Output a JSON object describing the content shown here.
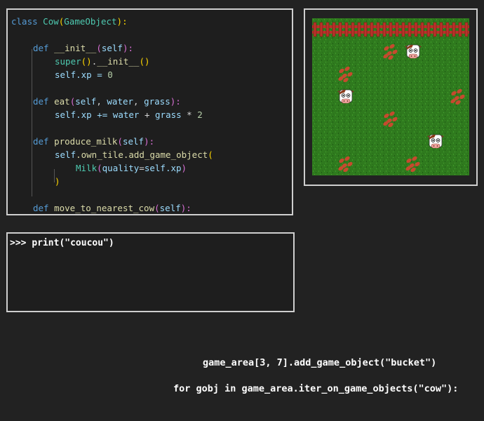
{
  "code": {
    "l1": {
      "a": "class",
      "b": "Cow",
      "c": "(",
      "d": "GameObject",
      "e": "):"
    },
    "l2": {
      "a": "def",
      "b": "__init__",
      "c": "(",
      "d": "self",
      "e": "):"
    },
    "l3": {
      "a": "super",
      "b": "()",
      "c": ".",
      "d": "__init__",
      "e": "()"
    },
    "l4": {
      "a": "self",
      "b": ".xp = ",
      "c": "0"
    },
    "l5": {
      "a": "def",
      "b": "eat",
      "c": "(",
      "d": "self",
      "e": ", ",
      "f": "water",
      "g": ", ",
      "h": "grass",
      "i": "):"
    },
    "l6": {
      "a": "self",
      "b": ".xp += ",
      "c": "water",
      "d": " + ",
      "e": "grass",
      "f": " * ",
      "g": "2"
    },
    "l7": {
      "a": "def",
      "b": "produce_milk",
      "c": "(",
      "d": "self",
      "e": "):"
    },
    "l8": {
      "a": "self",
      "b": ".own_tile.add_game_object",
      "c": "("
    },
    "l9": {
      "a": "Milk",
      "b": "(",
      "c": "quality",
      "d": "=",
      "e": "self",
      "f": ".xp",
      "g": ")"
    },
    "l10": {
      "a": ")"
    },
    "l11": {
      "a": "def",
      "b": "move_to_nearest_cow",
      "c": "(",
      "d": "self",
      "e": "):"
    }
  },
  "console": {
    "prompt": ">>> ",
    "command": "print(\"coucou\")"
  },
  "hints": {
    "line1": "game_area[3, 7].add_game_object(\"bucket\")",
    "line2": "for gobj in game_area.iter_on_game_objects(\"cow\"):"
  },
  "game": {
    "grid_cols": 7,
    "grid_rows": 7,
    "fence_row": 0,
    "cows": [
      {
        "col": 4,
        "row": 1
      },
      {
        "col": 1,
        "row": 3
      },
      {
        "col": 5,
        "row": 5
      }
    ],
    "dirt_patches": [
      {
        "col": 3,
        "row": 1
      },
      {
        "col": 1,
        "row": 2
      },
      {
        "col": 6,
        "row": 3
      },
      {
        "col": 3,
        "row": 4
      },
      {
        "col": 1,
        "row": 6
      },
      {
        "col": 4,
        "row": 6
      }
    ],
    "colors": {
      "grass": "#2f7a1e",
      "fence": "#b8332a",
      "dirt": "#c64a2e",
      "cow_patch": "#8b3a1a"
    }
  }
}
